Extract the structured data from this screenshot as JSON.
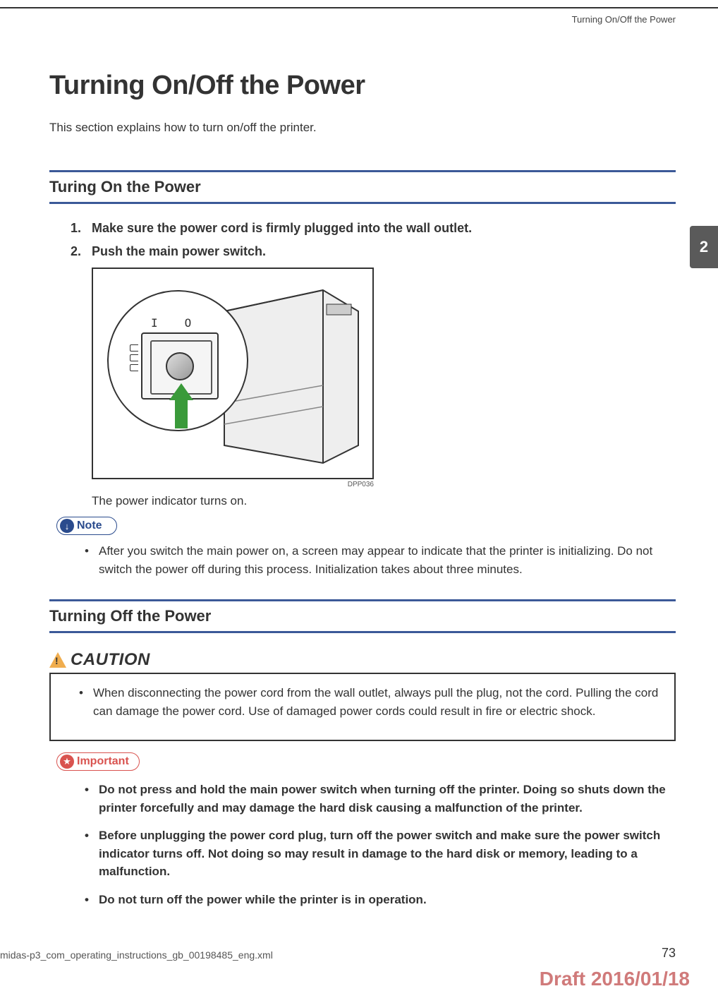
{
  "running_header": "Turning On/Off the Power",
  "chapter_number": "2",
  "page_title": "Turning On/Off the Power",
  "intro": "This section explains how to turn on/off the printer.",
  "section_on": {
    "title": "Turing On the Power",
    "steps": [
      {
        "num": "1.",
        "text": "Make sure the power cord is firmly plugged into the wall outlet."
      },
      {
        "num": "2.",
        "text": "Push the main power switch."
      }
    ],
    "figure_code": "DPP036",
    "figure_caption": "The power indicator turns on.",
    "note_label": "Note",
    "note_items": [
      "After you switch the main power on, a screen may appear to indicate that the printer is initializing. Do not switch the power off during this process. Initialization takes about three minutes."
    ]
  },
  "section_off": {
    "title": "Turning Off the Power",
    "caution_label": "CAUTION",
    "caution_items": [
      "When disconnecting the power cord from the wall outlet, always pull the plug, not the cord. Pulling the cord can damage the power cord. Use of damaged power cords could result in fire or electric shock."
    ],
    "important_label": "Important",
    "important_items": [
      "Do not press and hold the main power switch when turning off the printer. Doing so shuts down the printer forcefully and may damage the hard disk causing a malfunction of the printer.",
      "Before unplugging the power cord plug, turn off the power switch and make sure the power switch indicator turns off. Not doing so may result in damage to the hard disk or memory, leading to a malfunction.",
      "Do not turn off the power while the printer is in operation."
    ]
  },
  "footer": {
    "file": "midas-p3_com_operating_instructions_gb_00198485_eng.xml",
    "page": "73",
    "draft": "Draft 2016/01/18"
  }
}
